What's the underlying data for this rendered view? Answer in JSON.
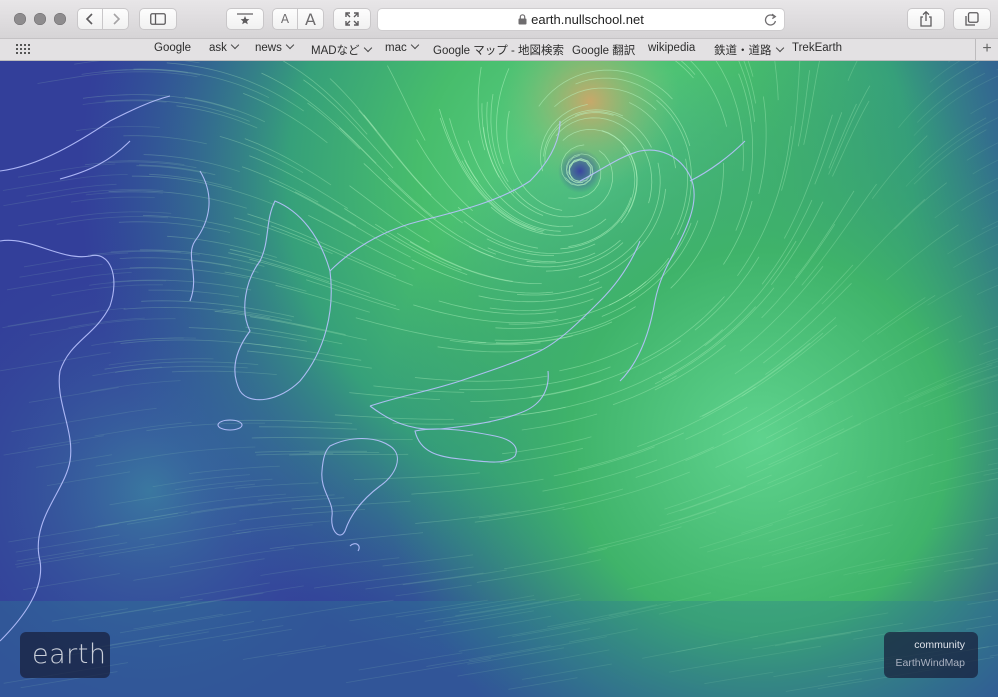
{
  "browser": {
    "url": "earth.nullschool.net",
    "bookmarks": [
      {
        "label": "Google",
        "menu": false
      },
      {
        "label": "ask",
        "menu": true
      },
      {
        "label": "news",
        "menu": true
      },
      {
        "label": "MADなど",
        "menu": true
      },
      {
        "label": "mac",
        "menu": true
      },
      {
        "label": "Google マップ - 地図検索",
        "menu": false
      },
      {
        "label": "Google 翻訳",
        "menu": false
      },
      {
        "label": "wikipedia",
        "menu": false
      },
      {
        "label": "鉄道・道路",
        "menu": true
      },
      {
        "label": "TrekEarth",
        "menu": false
      }
    ],
    "text_size_small": "A",
    "text_size_large": "A"
  },
  "map": {
    "logo": "earth",
    "community_label": "community",
    "community_link": "EarthWindMap",
    "colors": {
      "calm": "#333f9a",
      "moderate": "#2f8a7e",
      "strong": "#3cb85c",
      "stream": "#b9f7c4",
      "coastline": "#b9c2ff"
    }
  }
}
